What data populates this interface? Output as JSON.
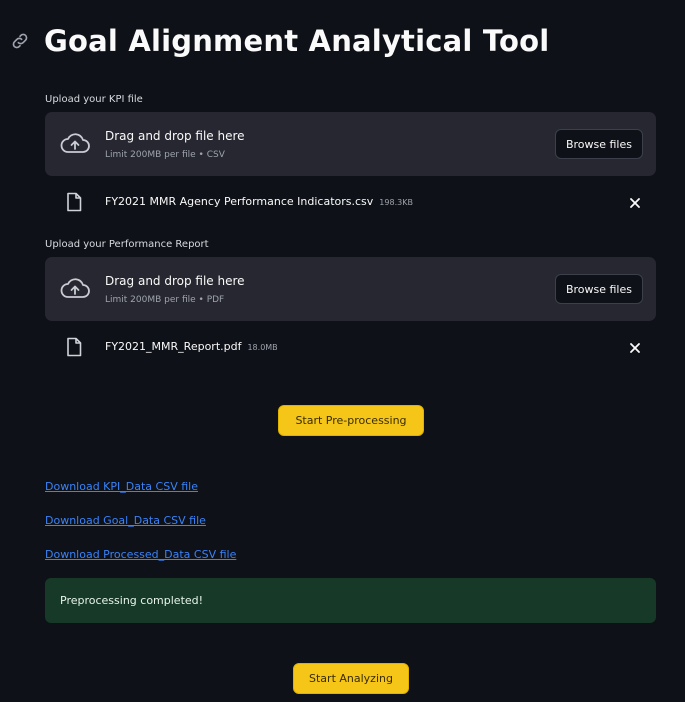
{
  "header": {
    "title": "Goal Alignment Analytical Tool",
    "anchor_icon": "link-icon"
  },
  "uploads": [
    {
      "label": "Upload your KPI file",
      "dropzone": {
        "main": "Drag and drop file here",
        "sub": "Limit 200MB per file • CSV",
        "button": "Browse files",
        "icon": "cloud-upload-icon"
      },
      "file": {
        "name": "FY2021 MMR Agency Performance Indicators.csv",
        "size": "198.3KB",
        "icon": "file-icon"
      }
    },
    {
      "label": "Upload your Performance Report",
      "dropzone": {
        "main": "Drag and drop file here",
        "sub": "Limit 200MB per file • PDF",
        "button": "Browse files",
        "icon": "cloud-upload-icon"
      },
      "file": {
        "name": "FY2021_MMR_Report.pdf",
        "size": "18.0MB",
        "icon": "file-icon"
      }
    }
  ],
  "actions": {
    "preprocess": "Start Pre-processing",
    "analyze": "Start Analyzing"
  },
  "downloads": [
    "Download KPI_Data CSV file",
    "Download Goal_Data CSV file",
    "Download Processed_Data CSV file"
  ],
  "status": {
    "message": "Preprocessing completed!"
  },
  "colors": {
    "background": "#0e1117",
    "surface": "#262730",
    "primary": "#f5c518",
    "link": "#3b82f6",
    "success_bg": "#173928"
  }
}
